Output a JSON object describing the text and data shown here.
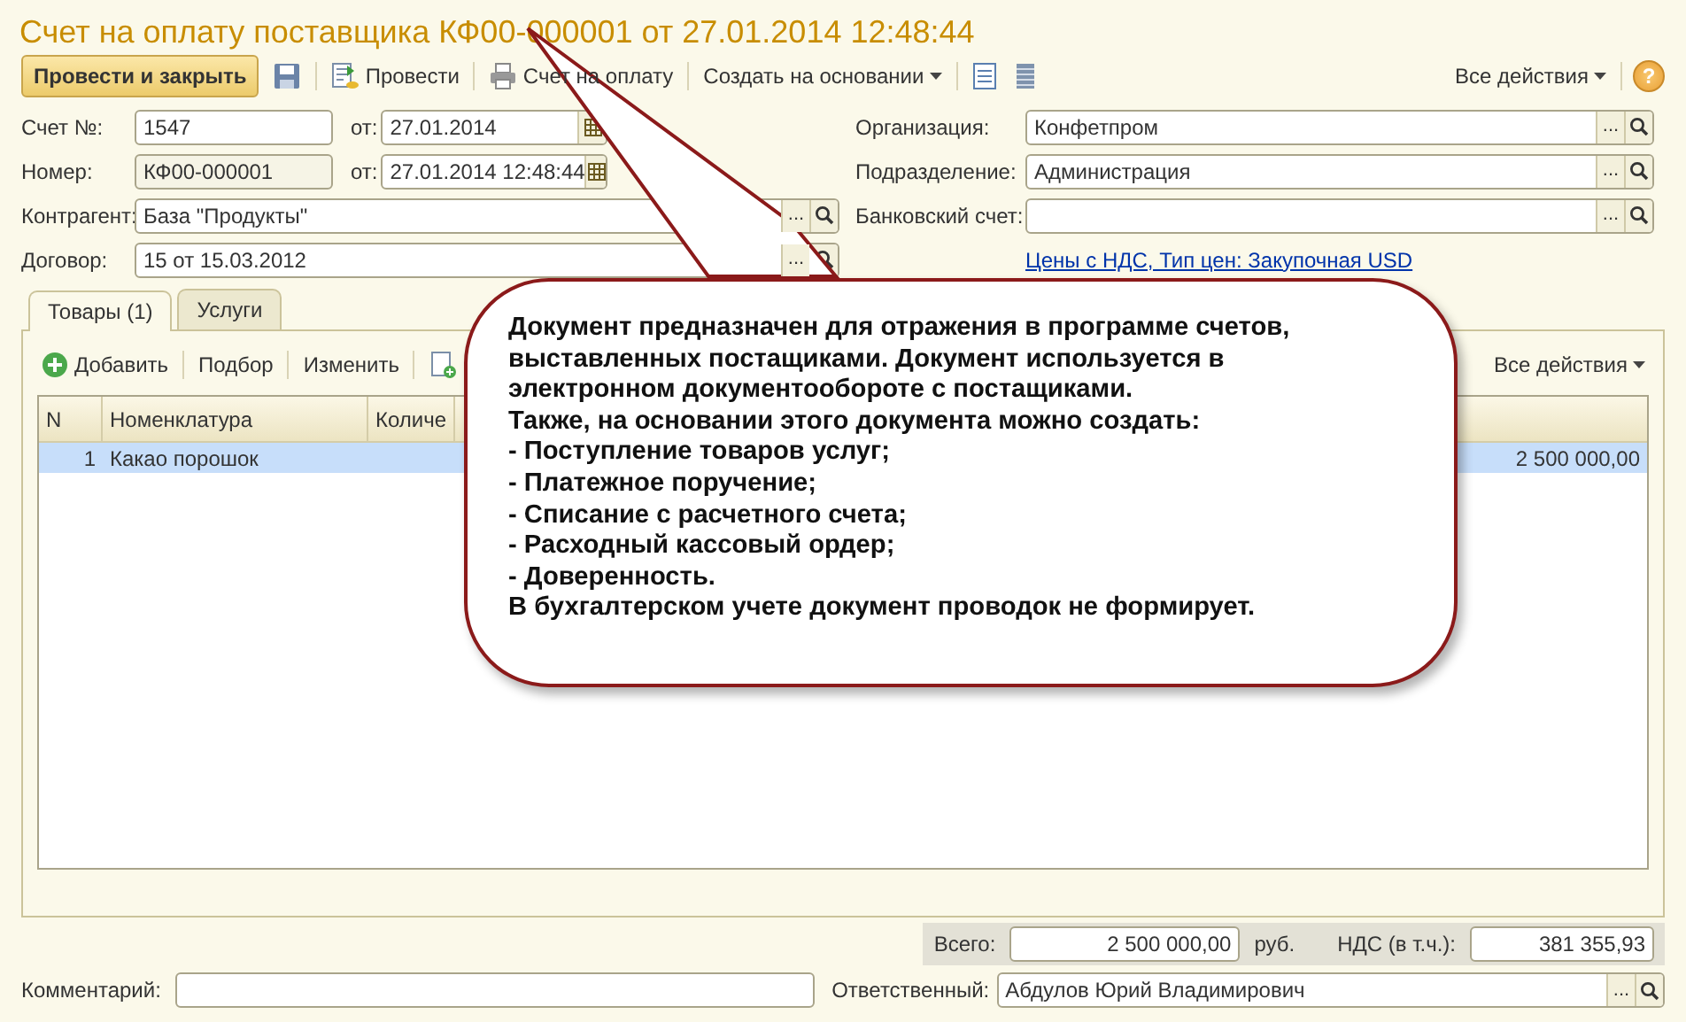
{
  "window": {
    "title": "Счет на оплату поставщика КФ00-000001 от 27.01.2014 12:48:44"
  },
  "toolbar": {
    "items": [
      {
        "kind": "primary",
        "label": "Провести и закрыть"
      },
      {
        "kind": "save"
      },
      {
        "kind": "post",
        "label": "Провести"
      },
      {
        "kind": "print",
        "label": "Счет на оплату"
      },
      {
        "kind": "menu",
        "label": "Создать на основании"
      },
      {
        "kind": "doc"
      },
      {
        "kind": "list"
      }
    ],
    "all_actions": "Все действия",
    "help": "?"
  },
  "fields_left": [
    {
      "kind": "numbered",
      "label": "Счет №:",
      "value": "1547",
      "date_label": "от:",
      "date_value": "27.01.2014",
      "readonly": false
    },
    {
      "kind": "numbered",
      "label": "Номер:",
      "value": "КФ00-000001",
      "date_label": "от:",
      "date_value": "27.01.2014 12:48:44",
      "readonly": true
    },
    {
      "kind": "ref",
      "label": "Контрагент:",
      "value": "База \"Продукты\"",
      "readonly": false,
      "choose": "..."
    },
    {
      "kind": "ref",
      "label": "Договор:",
      "value": "15 от 15.03.2012",
      "readonly": false,
      "choose": "..."
    }
  ],
  "fields_right": [
    {
      "label": "Организация:",
      "value": "Конфетпром",
      "choose": "..."
    },
    {
      "label": "Подразделение:",
      "value": "Администрация",
      "choose": "..."
    },
    {
      "label": "Банковский счет:",
      "choose": "..."
    }
  ],
  "prices_link": "Цены с НДС, Тип цен: Закупочная USD",
  "tabs": [
    {
      "label": "Товары (1)",
      "selected": true
    },
    {
      "label": "Услуги",
      "selected": false
    }
  ],
  "table_toolbar": {
    "items": [
      {
        "kind": "add",
        "label": "Добавить"
      },
      {
        "kind": "text",
        "label": "Подбор"
      },
      {
        "kind": "text",
        "label": "Изменить"
      },
      {
        "kind": "copy"
      }
    ],
    "all_actions": "Все действия"
  },
  "table": {
    "columns": [
      "N",
      "Номенклатура",
      "Количе"
    ],
    "rows": [
      {
        "selected": true,
        "number": "1",
        "item": "Какао порошок",
        "total": "2 500 000,00"
      }
    ]
  },
  "totals": {
    "total_label": "Всего:",
    "total": "2 500 000,00",
    "currency": "руб.",
    "vat_label": "НДС (в т.ч.):",
    "vat": "381 355,93"
  },
  "comment": {
    "label": "Комментарий:"
  },
  "responsible": {
    "label": "Ответственный:",
    "value": "Абдулов Юрий Владимирович",
    "choose": "..."
  },
  "callout": {
    "lines": [
      "Документ предназначен для отражения в программе счетов,",
      "выставленных постащиками. Документ используется в",
      "электронном документообороте с постащиками.",
      "Также, на основании этого документа можно создать:",
      "- Поступление товаров услуг;",
      "- Платежное поручение;",
      "- Списание с расчетного счета;",
      "- Расходный кассовый ордер;",
      "- Доверенность.",
      "В бухгалтерском учете документ проводок не формирует."
    ]
  }
}
